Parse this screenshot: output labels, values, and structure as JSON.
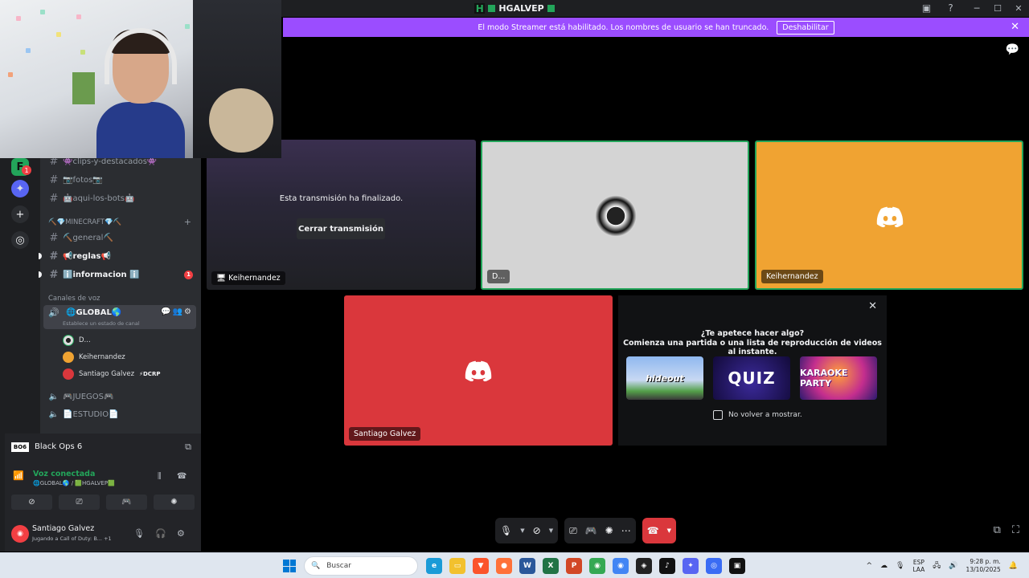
{
  "window": {
    "title": "HGALVEP",
    "logo": "H"
  },
  "banner": {
    "message": "El modo Streamer está habilitado. Los nombres de usuario se han truncado.",
    "button": "Deshabilitar"
  },
  "rail": {
    "badge": "1"
  },
  "channels": [
    {
      "name": "👾clips-y-destacados👾",
      "bold": false
    },
    {
      "name": "📷fotos📷",
      "bold": false
    },
    {
      "name": "🤖aqui-los-bots🤖",
      "bold": false
    }
  ],
  "category_minecraft": "⛏️💎MINECRAFT💎⛏️",
  "minecraft_channels": [
    {
      "name": "⛏️general⛏️"
    },
    {
      "name": "📢reglas📢"
    },
    {
      "name": "ℹ️informacion ℹ️",
      "badge": "1"
    }
  ],
  "voice_category": "Canales de voz",
  "voice_channel": {
    "name": "🌐GLOBAL🌎",
    "status": "Establece un estado de canal"
  },
  "voice_users": [
    {
      "name": "D...",
      "tag": ""
    },
    {
      "name": "Keihernandez",
      "tag": ""
    },
    {
      "name": "Santiago Galvez",
      "tag": "⚡DCRP"
    }
  ],
  "other_voice": [
    {
      "name": "🎮JUEGOS🎮"
    },
    {
      "name": "📄ESTUDIO📄"
    }
  ],
  "panel": {
    "game_logo": "BO6",
    "game_name": "Black Ops 6",
    "voice_status": "Voz conectada",
    "voice_path": "🌐GLOBAL🌎 / 🟩HGALVEP🟩",
    "user_name": "Santiago Galvez",
    "user_status": "Jugando a Call of Duty: B...",
    "user_status_extra": "+1"
  },
  "tiles": {
    "ended_message": "Esta transmisión ha finalizado.",
    "ended_button": "Cerrar transmisión",
    "ended_label": "Keihernandez",
    "d_label": "D...",
    "k_label": "Keihernandez",
    "s_label": "Santiago Galvez"
  },
  "activity": {
    "q1": "¿Te apetece hacer algo?",
    "q2": "Comienza una partida o una lista de reproducción de videos al instante.",
    "games": [
      "hideout",
      "QUIZ",
      "KARAOKE PARTY"
    ],
    "dont_show": "No volver a mostrar."
  },
  "taskbar": {
    "search_placeholder": "Buscar",
    "lang1": "ESP",
    "lang2": "LAA",
    "time": "9:28 p. m.",
    "date": "13/10/2025"
  },
  "colors": {
    "banner": "#9b4dff",
    "green": "#23a55a",
    "red": "#da373c",
    "orange": "#f0a332",
    "sidebar": "#2b2d31"
  }
}
